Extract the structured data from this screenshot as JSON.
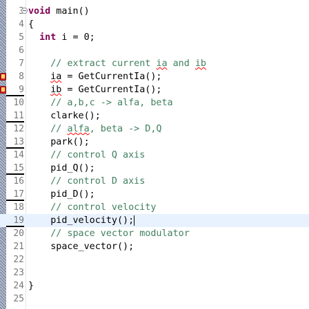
{
  "editor": {
    "language": "c",
    "colors": {
      "keyword": "#7f0055",
      "comment": "#3f7f5f",
      "line_number": "#787878",
      "current_line_bg": "#e8f2fe",
      "spelling_underline": "#ff0000"
    },
    "lines": [
      {
        "num": "3",
        "folded_marker": "⊖",
        "tokens": [
          {
            "t": "void",
            "k": "kw"
          },
          {
            "t": " main()",
            "k": ""
          }
        ]
      },
      {
        "num": "4",
        "tokens": [
          {
            "t": "{",
            "k": ""
          }
        ]
      },
      {
        "num": "5",
        "tokens": [
          {
            "t": "  ",
            "k": ""
          },
          {
            "t": "int",
            "k": "kw"
          },
          {
            "t": " i = 0;",
            "k": ""
          }
        ]
      },
      {
        "num": "6",
        "tokens": []
      },
      {
        "num": "7",
        "tokens": [
          {
            "t": "    // extract current ",
            "k": "cm"
          },
          {
            "t": "ia",
            "k": "cm sp"
          },
          {
            "t": " and ",
            "k": "cm"
          },
          {
            "t": "ib",
            "k": "cm sp"
          }
        ]
      },
      {
        "num": "8",
        "error": true,
        "tokens": [
          {
            "t": "    ",
            "k": ""
          },
          {
            "t": "ia",
            "k": "sp"
          },
          {
            "t": " = GetCurrentIa();",
            "k": ""
          }
        ]
      },
      {
        "num": "9",
        "error": true,
        "marked": true,
        "tokens": [
          {
            "t": "    ",
            "k": ""
          },
          {
            "t": "ib",
            "k": "sp"
          },
          {
            "t": " = GetCurrentIa();",
            "k": ""
          }
        ]
      },
      {
        "num": "10",
        "tokens": [
          {
            "t": "    // a,b,c -> alfa, beta",
            "k": "cm"
          }
        ]
      },
      {
        "num": "11",
        "marked": true,
        "tokens": [
          {
            "t": "    clarke();",
            "k": ""
          }
        ]
      },
      {
        "num": "12",
        "tokens": [
          {
            "t": "    // ",
            "k": "cm"
          },
          {
            "t": "alfa",
            "k": "cm sp"
          },
          {
            "t": ", beta -> D,Q",
            "k": "cm"
          }
        ]
      },
      {
        "num": "13",
        "marked": true,
        "tokens": [
          {
            "t": "    park();",
            "k": ""
          }
        ]
      },
      {
        "num": "14",
        "tokens": [
          {
            "t": "    // control Q axis",
            "k": "cm"
          }
        ]
      },
      {
        "num": "15",
        "marked": true,
        "tokens": [
          {
            "t": "    pid_Q();",
            "k": ""
          }
        ]
      },
      {
        "num": "16",
        "tokens": [
          {
            "t": "    // control D axis",
            "k": "cm"
          }
        ]
      },
      {
        "num": "17",
        "marked": true,
        "tokens": [
          {
            "t": "    pid_D();",
            "k": ""
          }
        ]
      },
      {
        "num": "18",
        "tokens": [
          {
            "t": "    // control velocity",
            "k": "cm"
          }
        ]
      },
      {
        "num": "19",
        "marked": true,
        "current": true,
        "caret": true,
        "tokens": [
          {
            "t": "    pid_velocity();",
            "k": ""
          }
        ]
      },
      {
        "num": "20",
        "tokens": [
          {
            "t": "    // space vector modulator",
            "k": "cm"
          }
        ]
      },
      {
        "num": "21",
        "tokens": [
          {
            "t": "    space_vector();",
            "k": ""
          }
        ]
      },
      {
        "num": "22",
        "tokens": []
      },
      {
        "num": "23",
        "tokens": []
      },
      {
        "num": "24",
        "tokens": [
          {
            "t": "}",
            "k": ""
          }
        ]
      },
      {
        "num": "25",
        "tokens": []
      }
    ]
  }
}
